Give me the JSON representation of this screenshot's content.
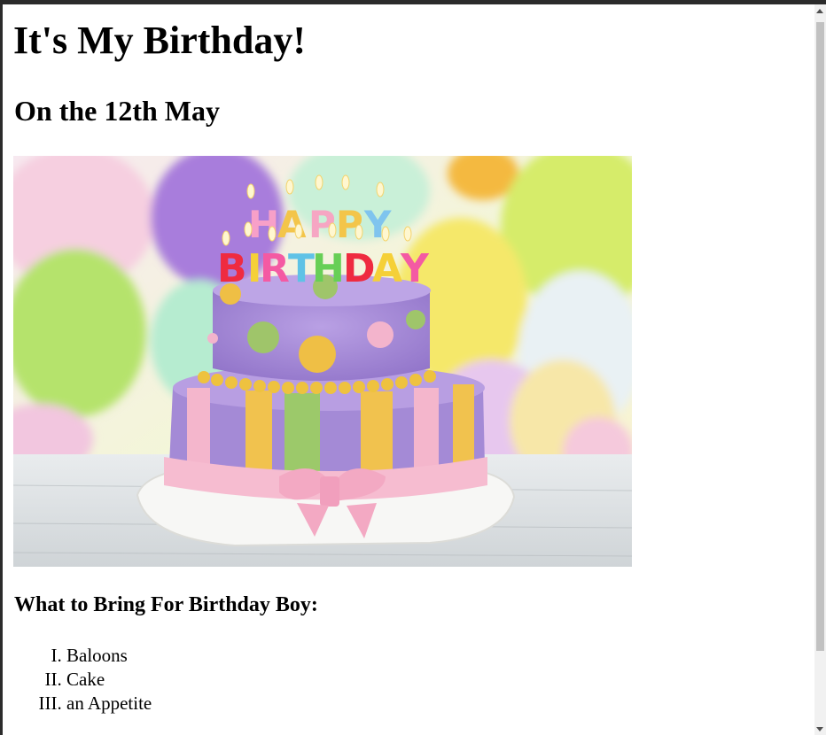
{
  "page": {
    "title": "It's My Birthday!",
    "subtitle": "On the 12th May",
    "image": {
      "alt": "Birthday cake",
      "candle_letters_top": "HAPPY",
      "candle_letters_bottom": "BIRTHDAY"
    },
    "list_heading": "What to Bring For Birthday Boy:",
    "items": [
      "Baloons",
      "Cake",
      "an Appetite"
    ]
  },
  "colors": {
    "window_frame": "#2b2b2b",
    "scrollbar_track": "#f1f1f1",
    "scrollbar_thumb": "#c1c1c1",
    "cake_purple": "#a78ad8",
    "cake_pink": "#f4b6cc",
    "cake_yellow": "#f1c24e",
    "cake_green": "#9cc96a"
  },
  "icons": {
    "scroll_up": "scroll-up-arrow-icon",
    "scroll_down": "scroll-down-arrow-icon"
  }
}
